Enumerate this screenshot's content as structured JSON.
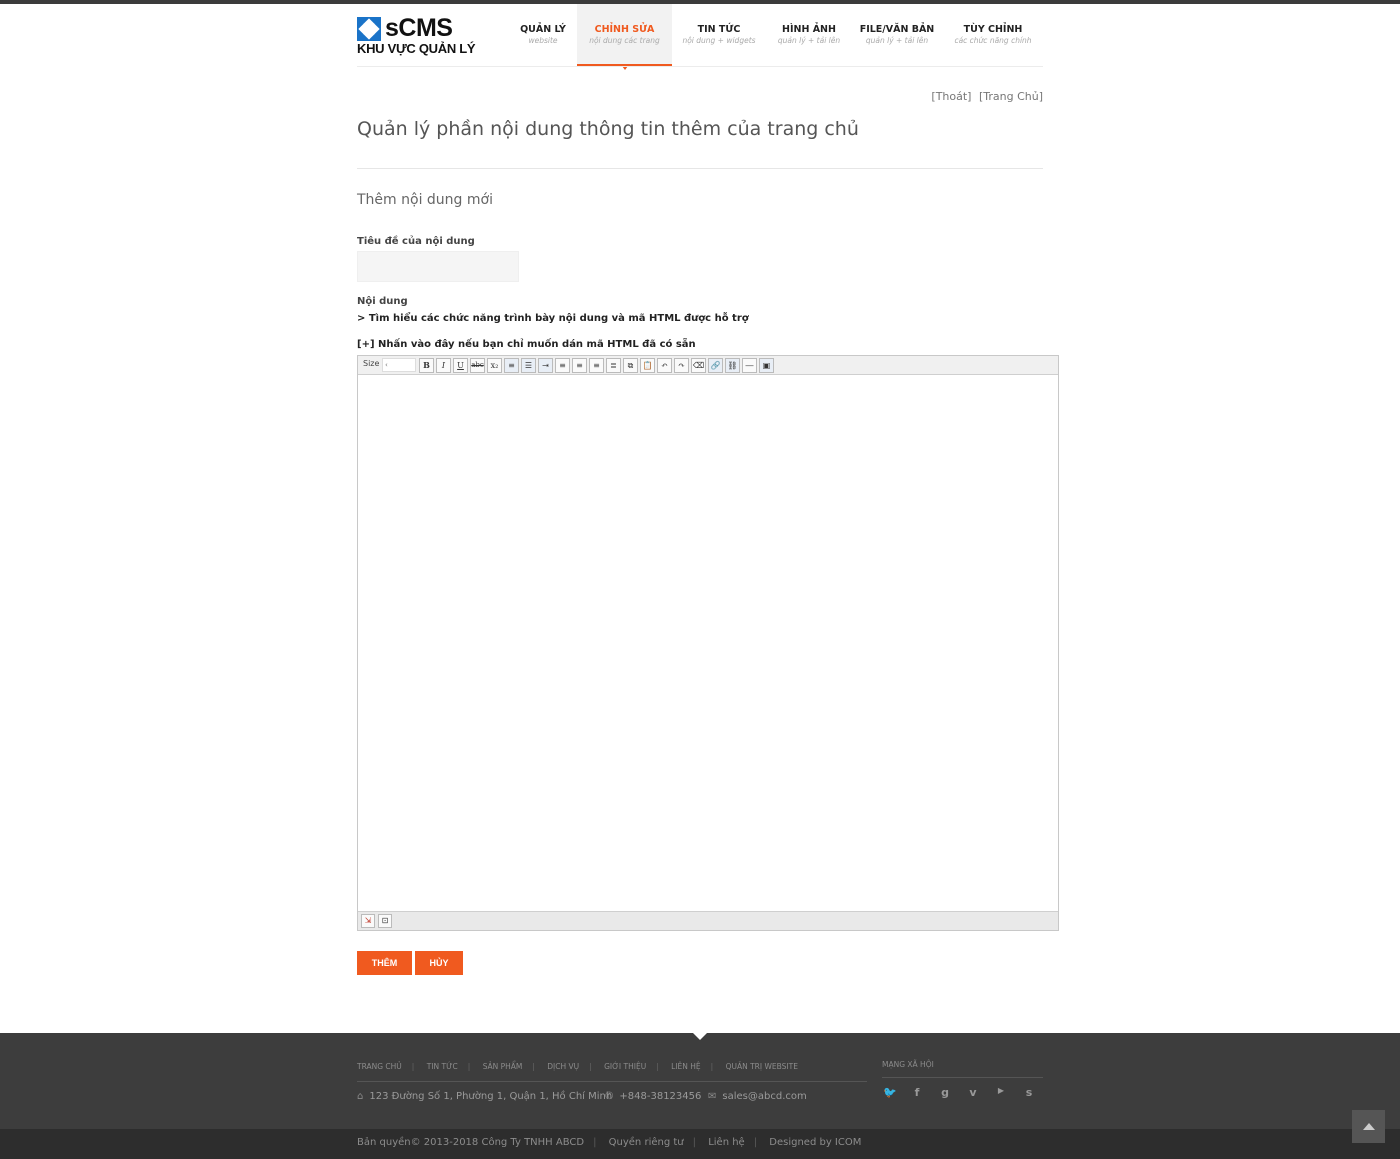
{
  "logo": {
    "brand": "sCMS",
    "subtitle": "KHU VỰC QUẢN LÝ"
  },
  "nav": [
    {
      "label": "QUẢN LÝ",
      "sub": "website"
    },
    {
      "label": "CHỈNH SỬA",
      "sub": "nội dung các trang",
      "active": true
    },
    {
      "label": "TIN TỨC",
      "sub": "nội dung + widgets"
    },
    {
      "label": "HÌNH ẢNH",
      "sub": "quản lý + tải lên"
    },
    {
      "label": "FILE/VĂN BẢN",
      "sub": "quản lý + tải lên"
    },
    {
      "label": "TÙY CHỈNH",
      "sub": "các chức năng chính"
    }
  ],
  "toplinks": {
    "logout": "[Thoát]",
    "home": "[Trang Chủ]"
  },
  "page": {
    "title": "Quản lý phần nội dung thông tin thêm của trang chủ",
    "section": "Thêm nội dung mới"
  },
  "form": {
    "title_label": "Tiêu đề của nội dung",
    "title_value": "",
    "content_label": "Nội dung",
    "help_link": "> Tìm hiểu các chức năng trình bày nội dung và mã HTML được hỗ trợ",
    "html_link": "[+] Nhấn vào đây nếu bạn chỉ muốn dán mã HTML đã có sẵn"
  },
  "editor": {
    "size_label": "Size",
    "size_value": "‹",
    "content": ""
  },
  "buttons": {
    "add": "THÊM",
    "cancel": "HỦY"
  },
  "footer": {
    "nav": [
      "TRANG CHỦ",
      "TIN TỨC",
      "SẢN PHẨM",
      "DỊCH VỤ",
      "GIỚI THIỆU",
      "LIÊN HỆ",
      "QUẢN TRỊ WEBSITE"
    ],
    "address": "123 Đường Số 1, Phường 1, Quận 1, Hồ Chí Minh",
    "phone": "+848-38123456",
    "email": "sales@abcd.com",
    "social_title": "MẠNG XÃ HỘI",
    "copyright": "Bản quyền© 2013-2018 Công Ty TNHH ABCD",
    "privacy": "Quyền riêng tư",
    "contact": "Liên hệ",
    "designed": "Designed by ICOM"
  },
  "colors": {
    "accent": "#f05a1f",
    "logo_blue": "#1a73c8",
    "footer": "#3d3d3d",
    "footer_bottom": "#2d2d2d"
  }
}
